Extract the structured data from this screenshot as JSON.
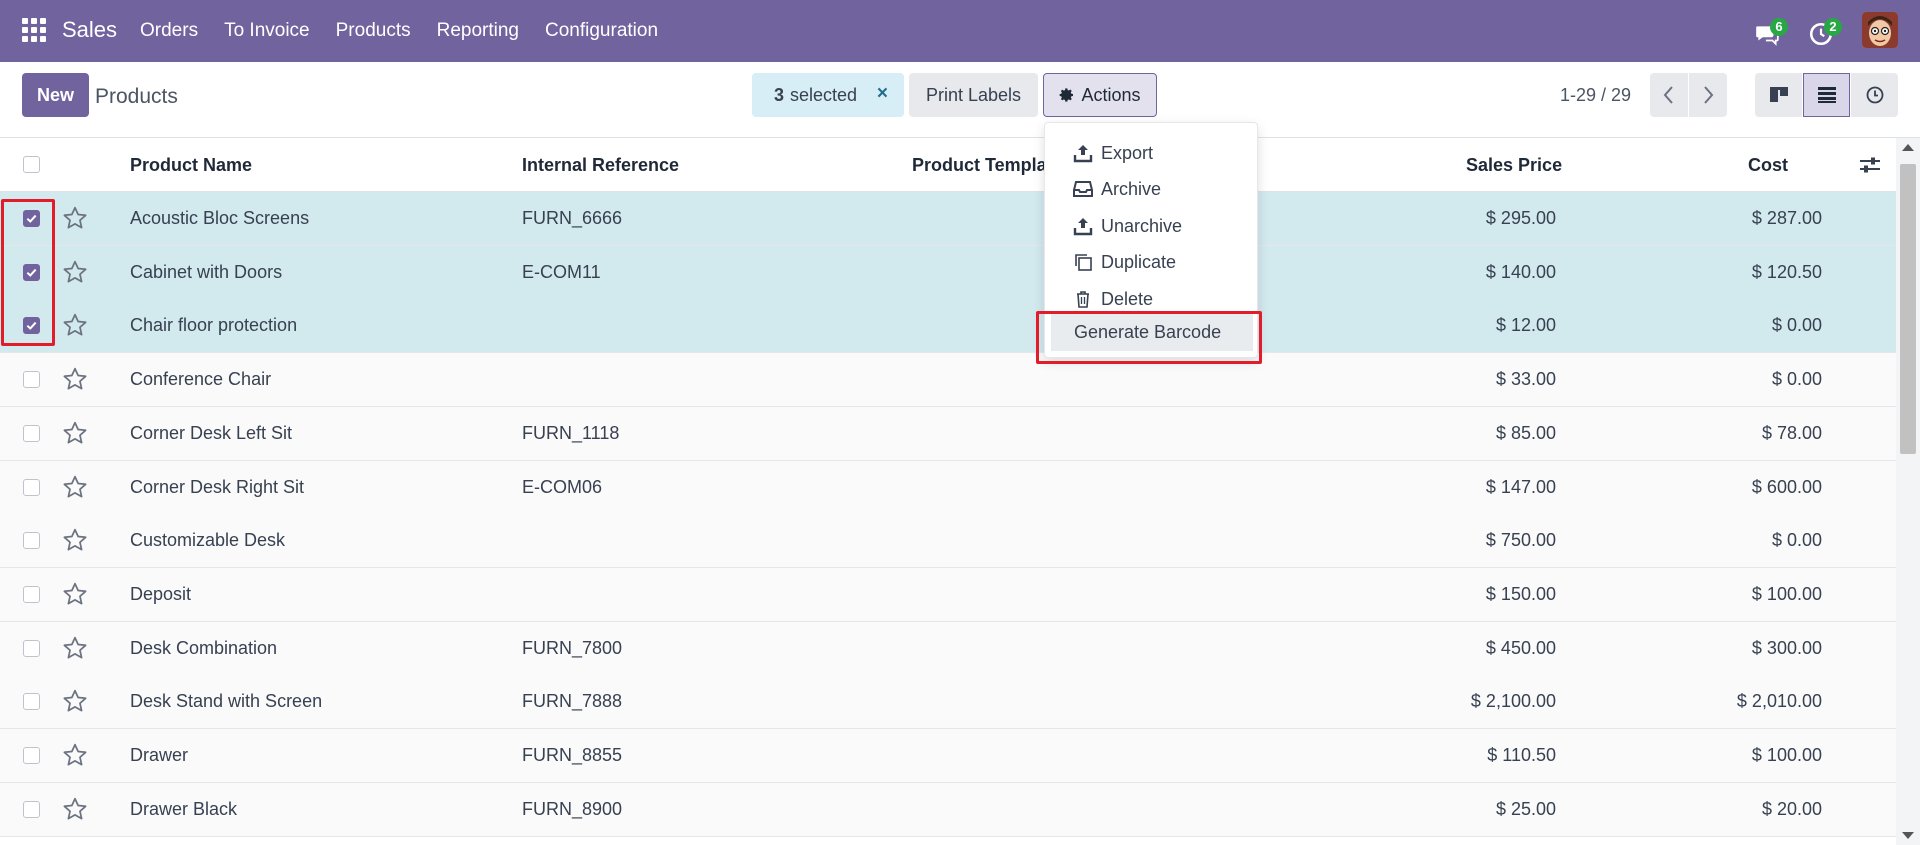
{
  "navbar": {
    "brand": "Sales",
    "menu": [
      "Orders",
      "To Invoice",
      "Products",
      "Reporting",
      "Configuration"
    ],
    "messages_count": "6",
    "activities_count": "2"
  },
  "control": {
    "new_label": "New",
    "title": "Products",
    "selected_count": "3",
    "selected_label": "selected",
    "clear_icon": "×",
    "print_labels": "Print Labels",
    "actions_label": "Actions",
    "pager": "1-29 / 29"
  },
  "actions_menu": {
    "items": [
      "Export",
      "Archive",
      "Unarchive",
      "Duplicate",
      "Delete"
    ],
    "generate_barcode": "Generate Barcode"
  },
  "table": {
    "headers": {
      "name": "Product Name",
      "reference": "Internal Reference",
      "template": "Product Templa",
      "sales_price": "Sales Price",
      "cost": "Cost"
    },
    "rows": [
      {
        "selected": true,
        "name": "Acoustic Bloc Screens",
        "ref": "FURN_6666",
        "price": "$ 295.00",
        "cost": "$ 287.00"
      },
      {
        "selected": true,
        "name": "Cabinet with Doors",
        "ref": "E-COM11",
        "price": "$ 140.00",
        "cost": "$ 120.50"
      },
      {
        "selected": true,
        "name": "Chair floor protection",
        "ref": "",
        "price": "$ 12.00",
        "cost": "$ 0.00"
      },
      {
        "selected": false,
        "name": "Conference Chair",
        "ref": "",
        "price": "$ 33.00",
        "cost": "$ 0.00"
      },
      {
        "selected": false,
        "name": "Corner Desk Left Sit",
        "ref": "FURN_1118",
        "price": "$ 85.00",
        "cost": "$ 78.00"
      },
      {
        "selected": false,
        "name": "Corner Desk Right Sit",
        "ref": "E-COM06",
        "price": "$ 147.00",
        "cost": "$ 600.00"
      },
      {
        "selected": false,
        "name": "Customizable Desk",
        "ref": "",
        "price": "$ 750.00",
        "cost": "$ 0.00"
      },
      {
        "selected": false,
        "name": "Deposit",
        "ref": "",
        "price": "$ 150.00",
        "cost": "$ 100.00"
      },
      {
        "selected": false,
        "name": "Desk Combination",
        "ref": "FURN_7800",
        "price": "$ 450.00",
        "cost": "$ 300.00"
      },
      {
        "selected": false,
        "name": "Desk Stand with Screen",
        "ref": "FURN_7888",
        "price": "$ 2,100.00",
        "cost": "$ 2,010.00"
      },
      {
        "selected": false,
        "name": "Drawer",
        "ref": "FURN_8855",
        "price": "$ 110.50",
        "cost": "$ 100.00"
      },
      {
        "selected": false,
        "name": "Drawer Black",
        "ref": "FURN_8900",
        "price": "$ 25.00",
        "cost": "$ 20.00"
      }
    ]
  },
  "colors": {
    "brand": "#71639e",
    "selected_row": "#d2e9ee",
    "highlight": "#e11d2a"
  }
}
